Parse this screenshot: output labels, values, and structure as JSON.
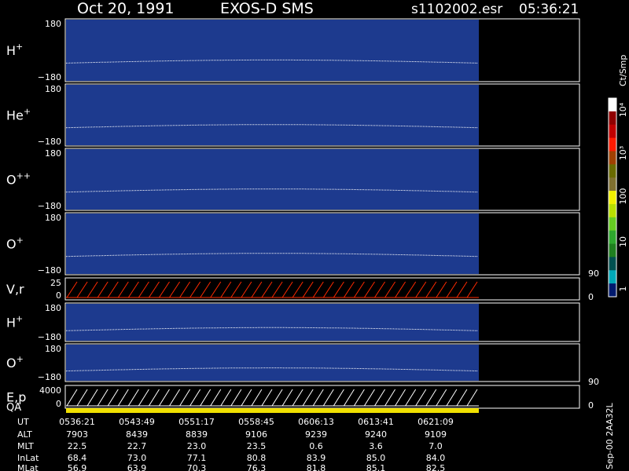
{
  "header": {
    "date": "Oct 20, 1991",
    "mission": "EXOS-D SMS",
    "file": "s1102002.esr",
    "time": "05:36:21"
  },
  "colorbar": {
    "label": "Ct/Smp",
    "ticks": [
      "10⁴",
      "10³",
      "100",
      "10",
      "1"
    ],
    "colors": [
      "#001a6e",
      "#00a8b8",
      "#005050",
      "#1f7f1f",
      "#2ea82e",
      "#66cc22",
      "#b8e000",
      "#f0f000",
      "#807030",
      "#6a6a00",
      "#a04000",
      "#ff1a00",
      "#c00000",
      "#900000",
      "#ffffff"
    ]
  },
  "colors": {
    "plot_background": "#1d3a8e",
    "no_data": "#000000",
    "trace": "#ffffff",
    "vr_trace": "#ff2a00",
    "qa_bar": "#f0e000"
  },
  "side_labels": [
    "90",
    "0",
    "90",
    "0"
  ],
  "footer_stamp": "Sep-00 2AA32L",
  "chart_data": {
    "type": "heatmap",
    "panels": [
      {
        "name": "H",
        "sup": "+",
        "ylim": [
          -180,
          180
        ],
        "ticks": [
          "180",
          "−180"
        ]
      },
      {
        "name": "He",
        "sup": "+",
        "ylim": [
          -180,
          180
        ],
        "ticks": [
          "180",
          "−180"
        ]
      },
      {
        "name": "O",
        "sup": "++",
        "ylim": [
          -180,
          180
        ],
        "ticks": [
          "180",
          "−180"
        ]
      },
      {
        "name": "O",
        "sup": "+",
        "ylim": [
          -180,
          180
        ],
        "ticks": [
          "180",
          "−180"
        ]
      },
      {
        "name": "V,r",
        "sup": "",
        "ylim": [
          0,
          25
        ],
        "ticks": [
          "25",
          "0"
        ]
      },
      {
        "name": "H",
        "sup": "+",
        "ylim": [
          -180,
          180
        ],
        "ticks": [
          "180",
          "−180"
        ]
      },
      {
        "name": "O",
        "sup": "+",
        "ylim": [
          -180,
          180
        ],
        "ticks": [
          "180",
          "−180"
        ]
      },
      {
        "name": "E,p",
        "sup": "",
        "ylim": [
          0,
          4000
        ],
        "ticks": [
          "4000",
          "0"
        ]
      }
    ],
    "qa_label": "QA",
    "ephemeris": {
      "rows": [
        {
          "label": "UT",
          "values": [
            "0536:21",
            "0543:49",
            "0551:17",
            "0558:45",
            "0606:13",
            "0613:41",
            "0621:09"
          ]
        },
        {
          "label": "ALT",
          "values": [
            "7903",
            "8439",
            "8839",
            "9106",
            "9239",
            "9240",
            "9109"
          ]
        },
        {
          "label": "MLT",
          "values": [
            "22.5",
            "22.7",
            "23.0",
            "23.5",
            "0.6",
            "3.6",
            "7.0"
          ]
        },
        {
          "label": "InLat",
          "values": [
            "68.4",
            "73.0",
            "77.1",
            "80.8",
            "83.9",
            "85.0",
            "84.0"
          ]
        },
        {
          "label": "MLat",
          "values": [
            "56.9",
            "63.9",
            "70.3",
            "76.3",
            "81.8",
            "85.1",
            "82.5"
          ]
        }
      ]
    }
  }
}
